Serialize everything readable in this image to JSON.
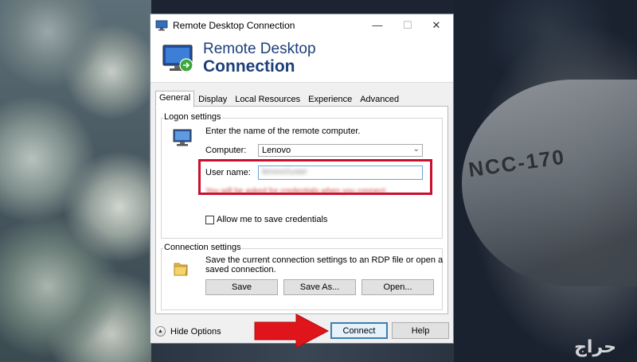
{
  "window": {
    "title": "Remote Desktop Connection",
    "banner_line1": "Remote Desktop",
    "banner_line2": "Connection"
  },
  "tabs": [
    {
      "label": "General",
      "active": true
    },
    {
      "label": "Display"
    },
    {
      "label": "Local Resources"
    },
    {
      "label": "Experience"
    },
    {
      "label": "Advanced"
    }
  ],
  "logon": {
    "group_label": "Logon settings",
    "instruction": "Enter the name of the remote computer.",
    "computer_label": "Computer:",
    "computer_value": "Lenovo",
    "username_label": "User name:",
    "username_value": "lenovo\\user",
    "hint": "You will be asked for credentials when you connect.",
    "save_credentials_label": "Allow me to save credentials",
    "save_credentials_checked": false
  },
  "connection": {
    "group_label": "Connection settings",
    "description_line1": "Save the current connection settings to an RDP file or open a",
    "description_line2": "saved connection.",
    "save_label": "Save",
    "save_as_label": "Save As...",
    "open_label": "Open..."
  },
  "footer": {
    "hide_options_label": "Hide Options",
    "connect_label": "Connect",
    "help_label": "Help"
  },
  "watermark": "حراج",
  "colors": {
    "accent": "#1c3f7a",
    "highlight_box": "#c8102e",
    "arrow": "#e0141b"
  }
}
